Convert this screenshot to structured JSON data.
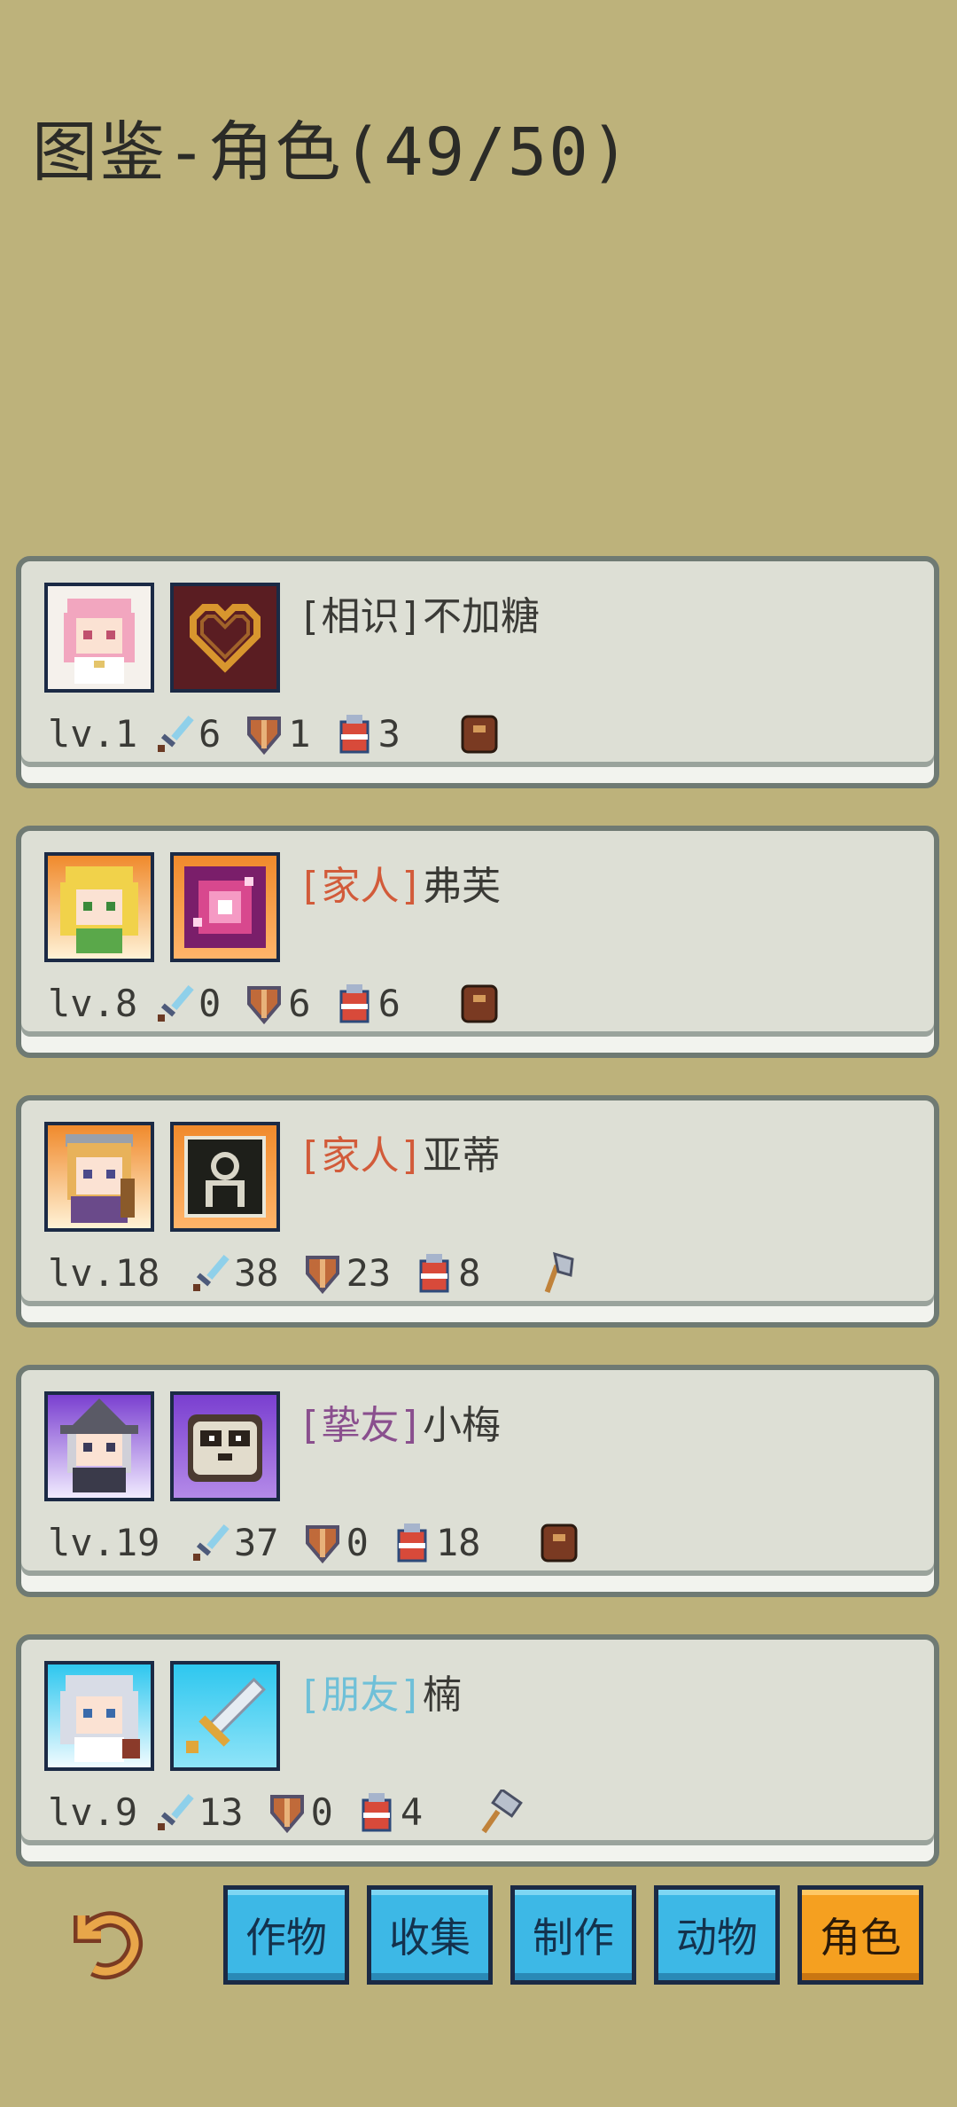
{
  "header": {
    "title": "图鉴-角色(49/50)"
  },
  "characters": [
    {
      "tag": "[相识]",
      "name": "不加糖",
      "tag_color": "#3a3a36",
      "level": "lv.1",
      "attack": "6",
      "defense": "1",
      "potion": "3",
      "tool": "bag-icon",
      "portrait_bg": "#f5f1ec",
      "emblem": "heart-emblem-icon"
    },
    {
      "tag": "[家人]",
      "name": "弗芙",
      "tag_color": "#d25b3a",
      "level": "lv.8",
      "attack": "0",
      "defense": "6",
      "potion": "6",
      "tool": "bag-icon",
      "portrait_bg": "#f08a2c",
      "emblem": "sparkle-emblem-icon"
    },
    {
      "tag": "[家人]",
      "name": "亚蒂",
      "tag_color": "#d25b3a",
      "level": "lv.18",
      "attack": "38",
      "defense": "23",
      "potion": "8",
      "tool": "axe-icon",
      "portrait_bg": "#f08a2c",
      "emblem": "silhouette-emblem-icon"
    },
    {
      "tag": "[挚友]",
      "name": "小梅",
      "tag_color": "#8a4f8e",
      "level": "lv.19",
      "attack": "37",
      "defense": "0",
      "potion": "18",
      "tool": "bag-icon",
      "portrait_bg": "#7a3fd0",
      "emblem": "panda-emblem-icon"
    },
    {
      "tag": "[朋友]",
      "name": "楠",
      "tag_color": "#6fc0d8",
      "level": "lv.9",
      "attack": "13",
      "defense": "0",
      "potion": "4",
      "tool": "hammer-icon",
      "portrait_bg": "#2ec7ef",
      "emblem": "sword-emblem-icon"
    }
  ],
  "tabs": [
    {
      "label": "作物",
      "active": false
    },
    {
      "label": "收集",
      "active": false
    },
    {
      "label": "制作",
      "active": false
    },
    {
      "label": "动物",
      "active": false
    },
    {
      "label": "角色",
      "active": true
    }
  ],
  "colors": {
    "background": "#bdb27b",
    "card": "#dddfd5",
    "tab": "#3db8e6",
    "tab_active": "#f5a020"
  }
}
